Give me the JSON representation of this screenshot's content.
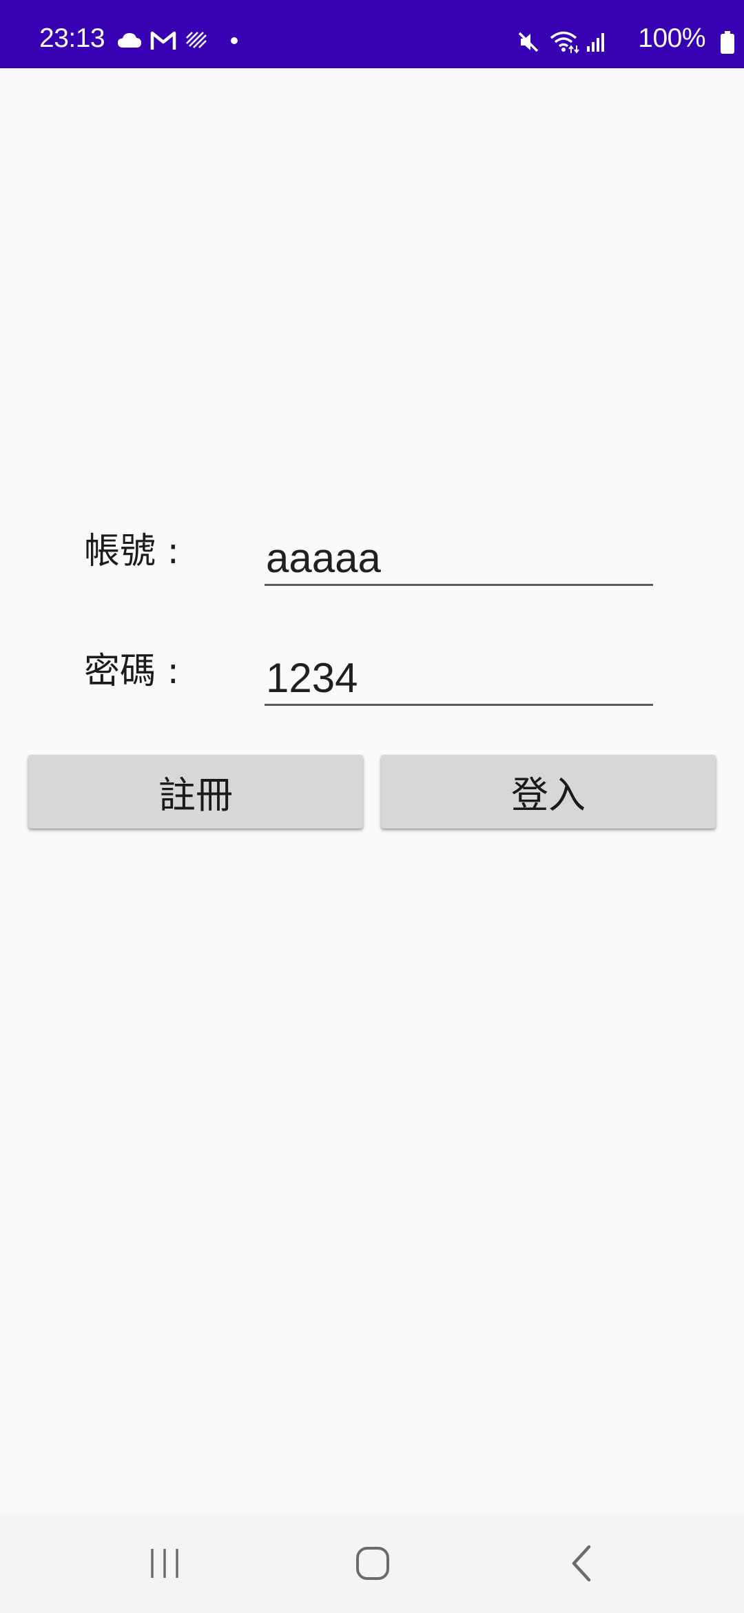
{
  "status_bar": {
    "time": "23:13",
    "battery_text": "100%",
    "background_color": "#3700b3",
    "left_icons": [
      "cloud-icon",
      "gmail-icon",
      "data-stripes-icon",
      "notification-dot-icon"
    ],
    "right_icons": [
      "mute-icon",
      "wifi-icon",
      "signal-icon",
      "battery-icon"
    ]
  },
  "form": {
    "account_label": "帳號 :",
    "account_value": "aaaaa",
    "password_label": "密碼 :",
    "password_value": "1234"
  },
  "buttons": {
    "register_label": "註冊",
    "login_label": "登入"
  },
  "nav_bar": {
    "icons": [
      "recent-apps-icon",
      "home-icon",
      "back-icon"
    ]
  }
}
